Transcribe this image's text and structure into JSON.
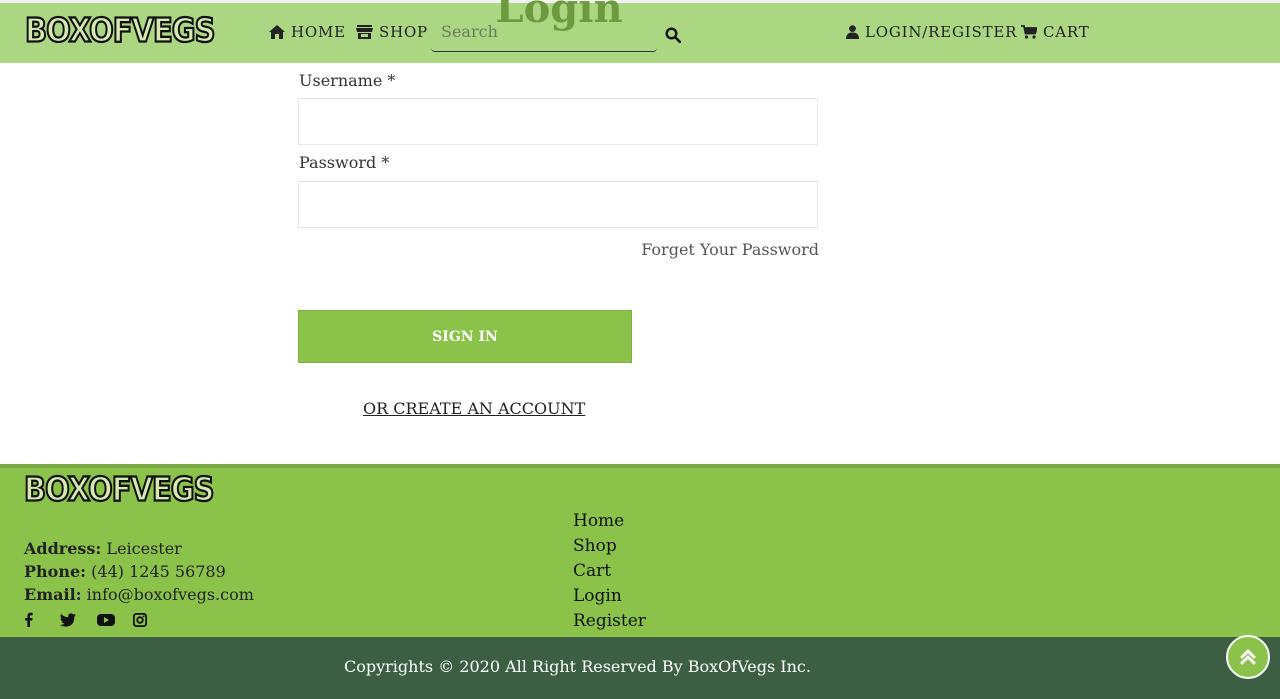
{
  "brand": {
    "logo_text": "BOXOFVEGS"
  },
  "header": {
    "nav": [
      {
        "label": "HOME",
        "icon": "home-icon"
      },
      {
        "label": "SHOP",
        "icon": "store-icon"
      },
      {
        "label": "LOGIN/REGISTER",
        "icon": "user-icon"
      },
      {
        "label": "CART",
        "icon": "cart-icon"
      }
    ],
    "search": {
      "placeholder": "Search",
      "value": "",
      "icon": "search-icon"
    }
  },
  "login": {
    "title": "Login",
    "username_label": "Username *",
    "username_value": "",
    "password_label": "Password *",
    "password_value": "",
    "forgot_link": "Forget Your Password",
    "signin_button": "SIGN IN",
    "create_account_link": "OR CREATE AN ACCOUNT"
  },
  "footer": {
    "address_label": "Address:",
    "address_value": "Leicester",
    "phone_label": "Phone:",
    "phone_value": "(44) 1245 56789",
    "email_label": "Email:",
    "email_value": "info@boxofvegs.com",
    "social": [
      "facebook-icon",
      "twitter-icon",
      "youtube-icon",
      "instagram-icon"
    ],
    "links": [
      "Home",
      "Shop",
      "Cart",
      "Login",
      "Register"
    ],
    "copyright": "Copyrights © 2020 All Right Reserved By BoxOfVegs Inc."
  },
  "colors": {
    "header_bg": "#acd782",
    "footer_bg": "#8bc34a",
    "copyright_bg": "#3c5f44",
    "button_bg": "#8bc34a",
    "title_color": "#6e9a3f"
  }
}
